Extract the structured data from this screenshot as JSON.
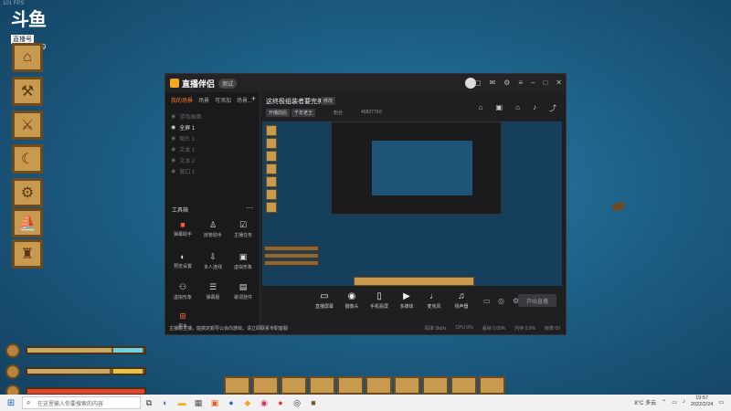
{
  "overlay": {
    "fps": "101 FPS",
    "logo_text": "斗鱼",
    "logo_sub": "直播号",
    "room_id": "4582779"
  },
  "colors": {
    "accent": "#ff7a2a",
    "ocean": "#1d5f85",
    "wood": "#c89a4f",
    "health": "#e0442a",
    "water": "#6fd0e0",
    "food": "#e8c14a"
  },
  "app": {
    "name": "直播伴侣",
    "version_label": "测试",
    "tabs": [
      "我的场景",
      "场景",
      "可添加",
      "场景..."
    ],
    "sources": [
      "游戏画面",
      "全屏 1",
      "图片 1",
      "文本 1",
      "文本 2",
      "窗口 1"
    ],
    "tools_title": "工具箱",
    "tools": [
      {
        "label": "弹幕助手",
        "icon": "gift-icon"
      },
      {
        "label": "房管助手",
        "icon": "user-icon"
      },
      {
        "label": "主播任务",
        "icon": "task-icon"
      },
      {
        "label": "预览设置",
        "icon": "preview-icon"
      },
      {
        "label": "多人连线",
        "icon": "connect-icon"
      },
      {
        "label": "虚拟形象",
        "icon": "avatar-icon"
      },
      {
        "label": "虚拟形象",
        "icon": "vr-icon"
      },
      {
        "label": "弹幕姬",
        "icon": "barrage-icon"
      },
      {
        "label": "歌词挂件",
        "icon": "lyrics-icon"
      },
      {
        "label": "更多",
        "icon": "more-icon"
      }
    ],
    "notice": "主播助主播，能搞定颜导公会向游戏，请立即联系专职客服",
    "stream_title": "这终极组装者要完美",
    "edit_label": "修改",
    "category_1": "开播前后",
    "category_2": "千年老王",
    "fans_label": "粉丝",
    "room_id": "4582779",
    "likes": "0",
    "controls": [
      {
        "label": "直播屏幕",
        "icon": "screen-icon"
      },
      {
        "label": "摄像头",
        "icon": "camera-icon"
      },
      {
        "label": "手机投屏",
        "icon": "phone-icon"
      },
      {
        "label": "多媒体",
        "icon": "media-icon"
      },
      {
        "label": "麦克风",
        "icon": "mic-icon"
      },
      {
        "label": "扬声器",
        "icon": "speaker-icon"
      }
    ],
    "start_label": "开始直播",
    "status": [
      "码率 0kb/s",
      "CPU 0%",
      "丢帧 0.00%",
      "内存 0.0%",
      "帧率 00"
    ]
  },
  "taskbar": {
    "search_placeholder": "在这里输入你要搜索的内容",
    "weather": "8°C 多云",
    "time": "19:57",
    "date": "2022/2/24"
  }
}
